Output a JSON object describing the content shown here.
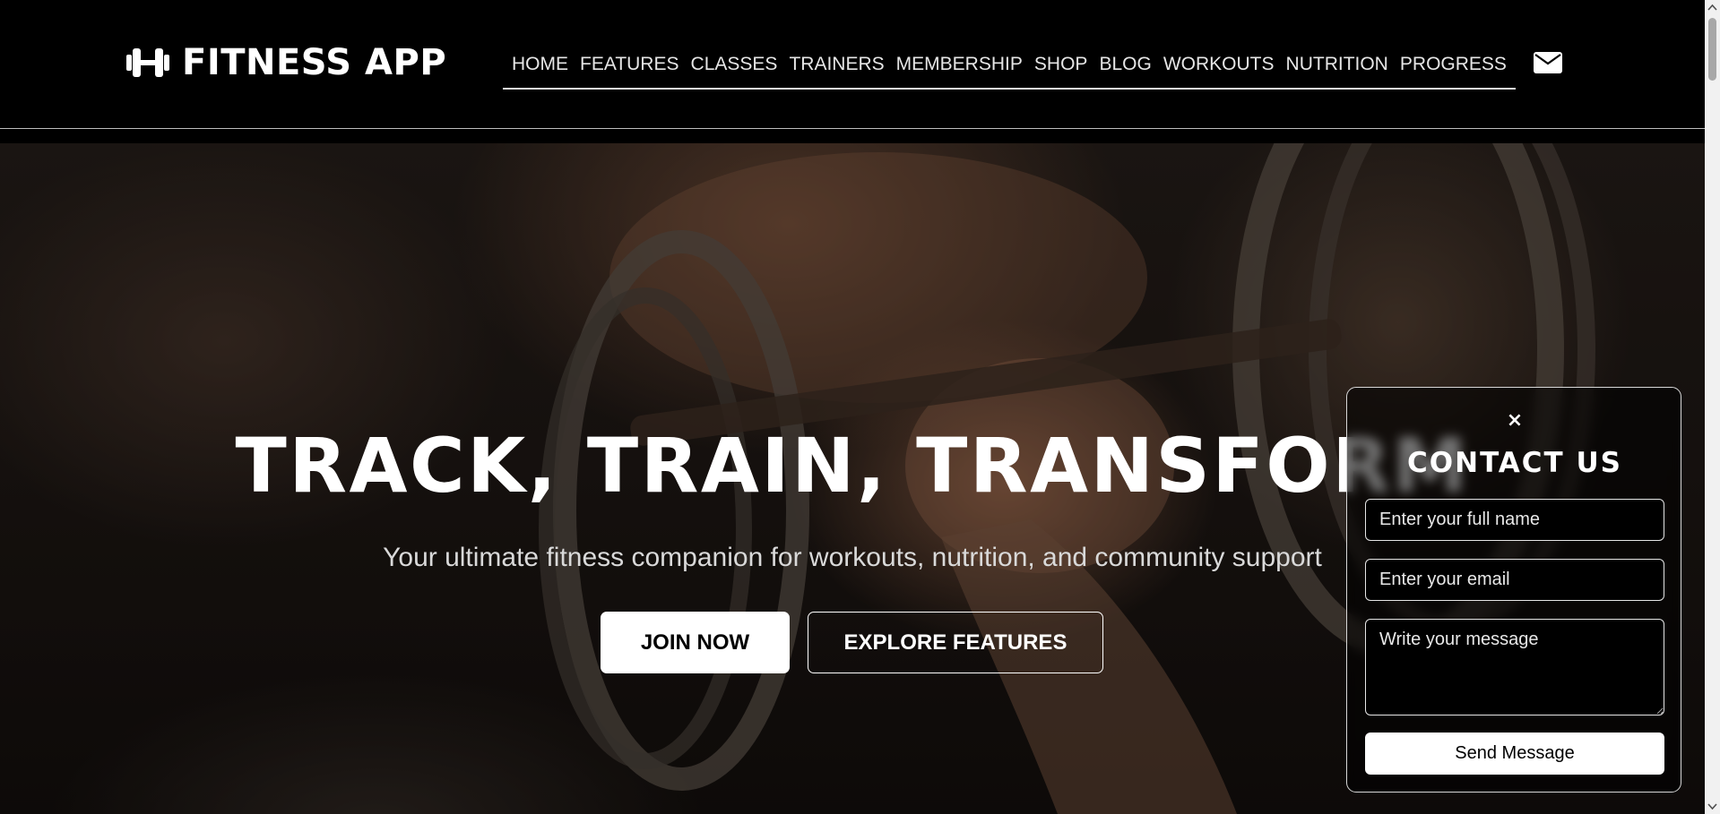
{
  "header": {
    "brand": "FITNESS APP",
    "logo_icon": "dumbbell-icon",
    "nav": [
      {
        "label": "HOME"
      },
      {
        "label": "FEATURES"
      },
      {
        "label": "CLASSES"
      },
      {
        "label": "TRAINERS"
      },
      {
        "label": "MEMBERSHIP"
      },
      {
        "label": "SHOP"
      },
      {
        "label": "BLOG"
      },
      {
        "label": "WORKOUTS"
      },
      {
        "label": "NUTRITION"
      },
      {
        "label": "PROGRESS"
      }
    ],
    "contact_icon": "envelope-icon"
  },
  "hero": {
    "title": "TRACK, TRAIN, TRANSFORM",
    "subtitle": "Your ultimate fitness companion for workouts, nutrition, and community support",
    "primary_cta": "JOIN NOW",
    "secondary_cta": "EXPLORE FEATURES"
  },
  "contact_panel": {
    "close_glyph": "×",
    "title": "CONTACT US",
    "name_placeholder": "Enter your full name",
    "email_placeholder": "Enter your email",
    "message_placeholder": "Write your message",
    "submit_label": "Send Message"
  },
  "colors": {
    "background": "#000000",
    "text": "#ffffff",
    "button_fill": "#ffffff",
    "button_text": "#000000"
  }
}
